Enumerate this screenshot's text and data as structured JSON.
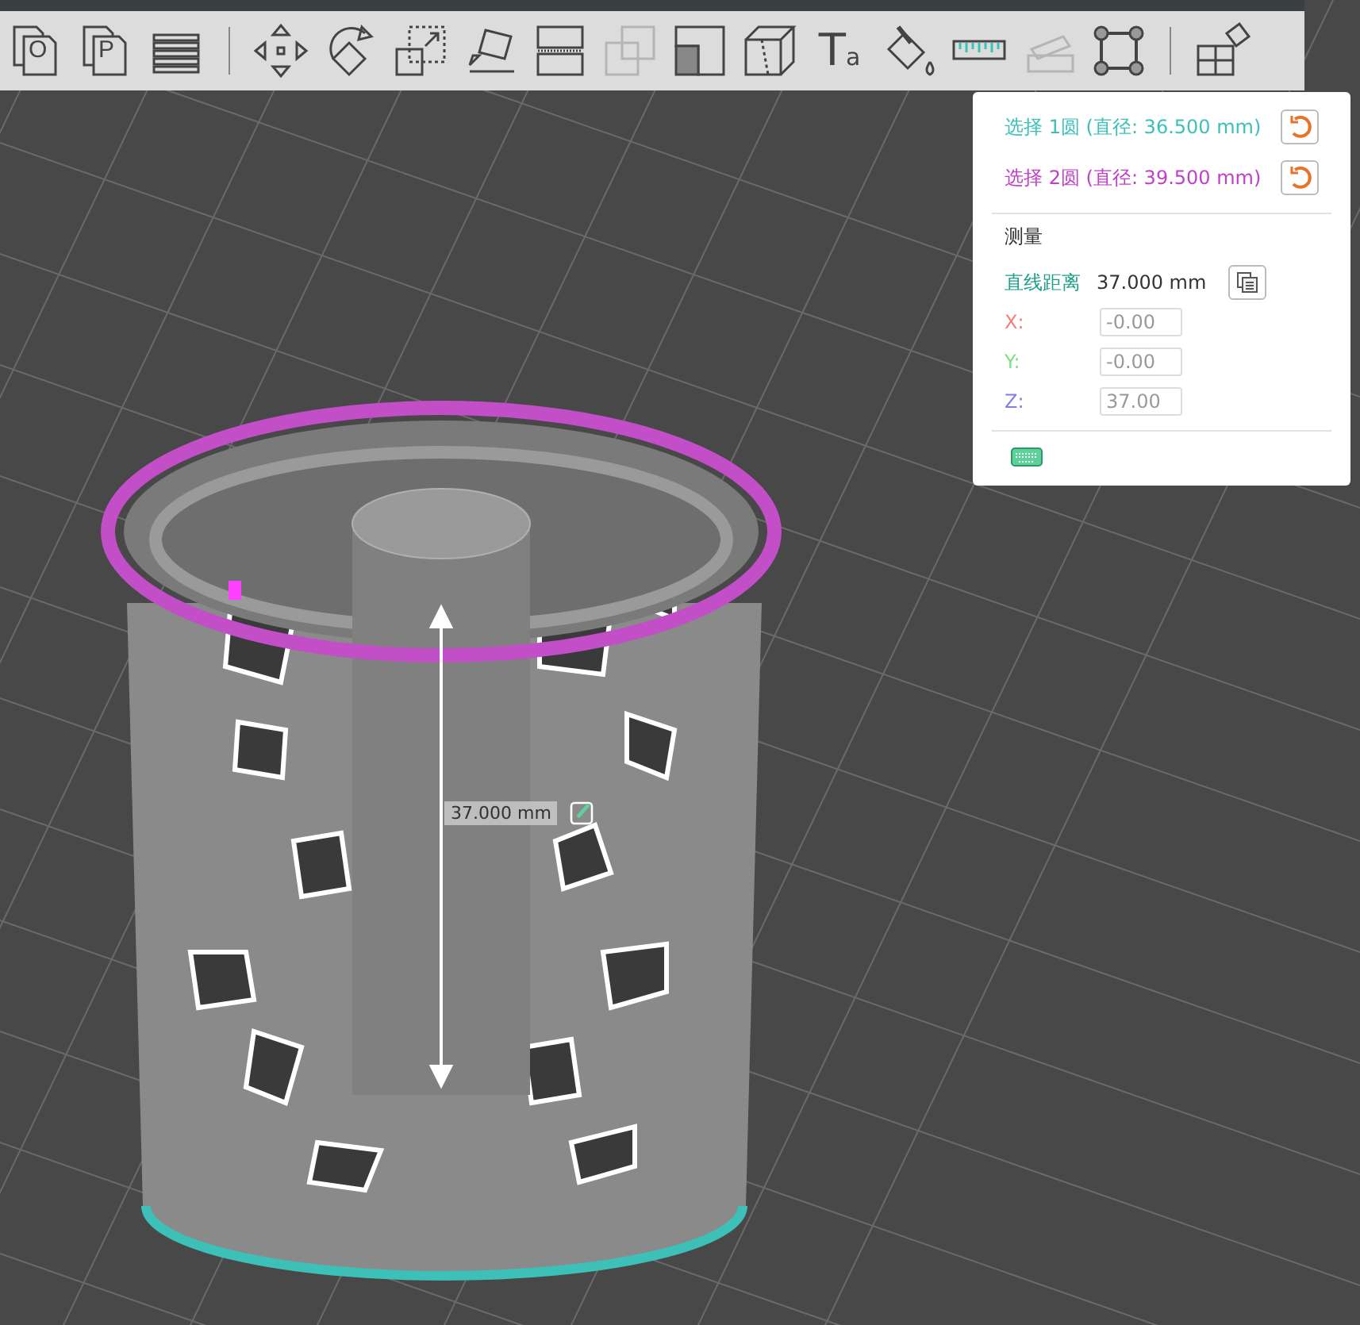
{
  "toolbar": {
    "tools": [
      {
        "kind": "plate",
        "label": "O",
        "disabled": false
      },
      {
        "kind": "plate",
        "label": "P",
        "disabled": false
      },
      {
        "kind": "layers",
        "disabled": false
      },
      {
        "kind": "divider"
      },
      {
        "kind": "move",
        "disabled": false
      },
      {
        "kind": "rotate",
        "disabled": false
      },
      {
        "kind": "scale",
        "disabled": false
      },
      {
        "kind": "lay-flat",
        "disabled": false
      },
      {
        "kind": "cut",
        "disabled": false
      },
      {
        "kind": "boolean",
        "disabled": true
      },
      {
        "kind": "support",
        "disabled": false
      },
      {
        "kind": "seam",
        "disabled": false
      },
      {
        "kind": "text",
        "label": "T",
        "sub": "a",
        "disabled": false
      },
      {
        "kind": "paint",
        "disabled": false
      },
      {
        "kind": "measure",
        "disabled": false
      },
      {
        "kind": "assembly",
        "disabled": true
      },
      {
        "kind": "brim",
        "disabled": false
      },
      {
        "kind": "divider"
      },
      {
        "kind": "split",
        "disabled": false
      }
    ]
  },
  "measure_panel": {
    "selections": [
      {
        "label": "选择 1圆 (直径: 36.500 mm)",
        "color": "#3cc0b8"
      },
      {
        "label": "选择 2圆 (直径: 39.500 mm)",
        "color": "#c040c8"
      }
    ],
    "title": "测量",
    "distance_label": "直线距离",
    "distance_value": "37.000 mm",
    "axes": [
      {
        "label": "X:",
        "value": "-0.00",
        "color": "#f08080"
      },
      {
        "label": "Y:",
        "value": "-0.00",
        "color": "#80e080"
      },
      {
        "label": "Z:",
        "value": "37.00",
        "color": "#8080e0"
      }
    ]
  },
  "viewport": {
    "dimension_label": "37.000 mm"
  }
}
